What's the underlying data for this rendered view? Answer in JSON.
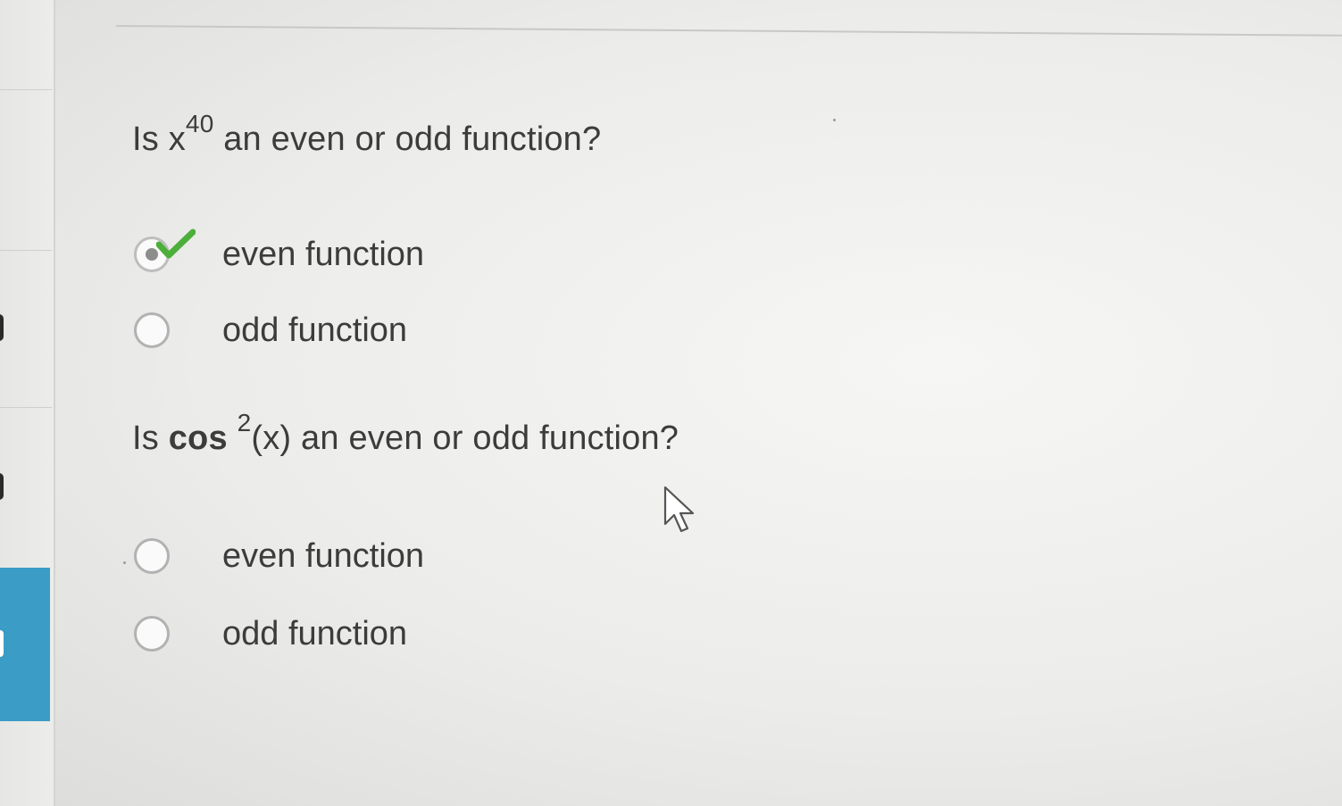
{
  "questions": [
    {
      "prefix": "Is ",
      "func": "x",
      "exponent": "40",
      "suffix": " an even or odd function?",
      "options": [
        {
          "label": "even function",
          "selected": true,
          "correct": true
        },
        {
          "label": "odd function",
          "selected": false
        }
      ]
    },
    {
      "prefix": "Is ",
      "func": "cos",
      "exponent": "2",
      "suffix": "(x) an even or odd function?",
      "options": [
        {
          "label": "even function",
          "selected": false
        },
        {
          "label": "odd function",
          "selected": false
        }
      ]
    }
  ],
  "colors": {
    "accent": "#3b9cc6",
    "check": "#4caf3a",
    "text": "#3c3c3c"
  },
  "icons": {
    "check": "check-icon",
    "cursor": "cursor-icon"
  }
}
